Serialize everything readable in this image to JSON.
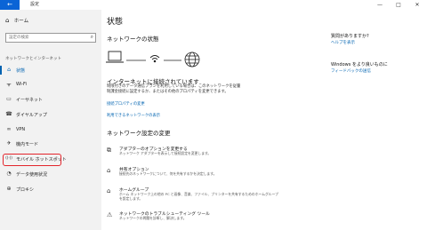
{
  "window": {
    "back_glyph": "←",
    "title": "設定",
    "minimize": "—",
    "maximize": "□",
    "close": "✕"
  },
  "sidebar": {
    "home": "ホーム",
    "search_placeholder": "設定の検索",
    "section_title": "ネットワークとインターネット",
    "items": [
      {
        "label": "状態",
        "icon": "status-icon",
        "glyph": "⌂"
      },
      {
        "label": "Wi-Fi",
        "icon": "wifi-icon",
        "glyph": "ᯤ"
      },
      {
        "label": "イーサネット",
        "icon": "ethernet-icon",
        "glyph": "▭"
      },
      {
        "label": "ダイヤルアップ",
        "icon": "dialup-icon",
        "glyph": "☎"
      },
      {
        "label": "VPN",
        "icon": "vpn-icon",
        "glyph": "∞"
      },
      {
        "label": "機内モード",
        "icon": "airplane-icon",
        "glyph": "✈"
      },
      {
        "label": "モバイル ホットスポット",
        "icon": "hotspot-icon",
        "glyph": "((·))"
      },
      {
        "label": "データ使用状況",
        "icon": "data-usage-icon",
        "glyph": "◔"
      },
      {
        "label": "プロキシ",
        "icon": "proxy-icon",
        "glyph": "⊕"
      }
    ],
    "active_index": 0,
    "highlight_color": "#e3242b"
  },
  "main": {
    "title": "状態",
    "network_status_heading": "ネットワークの状態",
    "connected_heading": "インターネットに接続されています",
    "connected_desc_1": "制限付きのデータ通信プランを利用している場合は、このネットワークを従量",
    "connected_desc_2": "制課金接続に設定するか、またはその他のプロパティを変更できます。",
    "link_change_props": "接続プロパティの変更",
    "link_show_networks": "利用できるネットワークの表示",
    "change_heading": "ネットワーク設定の変更",
    "options": [
      {
        "title": "アダプターのオプションを変更する",
        "desc": "ネットワーク アダプターを表示して接続設定を変更します。",
        "icon": "adapter-icon",
        "glyph": "⧉"
      },
      {
        "title": "共有オプション",
        "desc": "接続先のネットワークについて、何を共有するかを決定します。",
        "icon": "sharing-icon",
        "glyph": "⌂"
      },
      {
        "title": "ホームグループ",
        "desc": "ホーム ネットワーク上の他の PC と画像、音楽、ファイル、プリンターを共有するためのホームグループを設定します。",
        "icon": "homegroup-icon",
        "glyph": "⌂"
      },
      {
        "title": "ネットワークのトラブルシューティング ツール",
        "desc": "ネットワークの問題を診断し、解決します。",
        "icon": "troubleshoot-icon",
        "glyph": "⚠"
      }
    ]
  },
  "right": {
    "question": "質問がありますか?",
    "help_link": "ヘルプを表示",
    "improve": "Windows をより良いものに",
    "feedback_link": "フィードバックの送信"
  },
  "colors": {
    "accent": "#0063b1",
    "sidebar_bg": "#f2f2f2",
    "back_bg": "#0a64d6"
  }
}
